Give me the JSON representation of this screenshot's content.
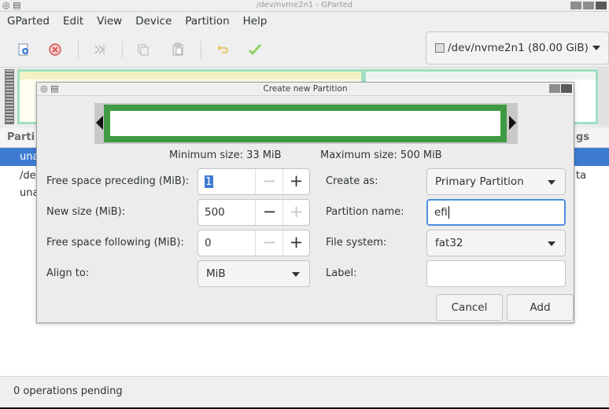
{
  "window": {
    "title": "/dev/nvme2n1 - GParted"
  },
  "menubar": [
    "GParted",
    "Edit",
    "View",
    "Device",
    "Partition",
    "Help"
  ],
  "toolbar": {
    "icons": [
      "new-partition-icon",
      "delete-icon",
      "resize-move-icon",
      "copy-icon",
      "paste-icon",
      "undo-icon",
      "apply-icon"
    ]
  },
  "device_selector": {
    "value": "/dev/nvme2n1 (80.00 GiB)"
  },
  "list": {
    "header_left": "Parti",
    "header_right": "gs",
    "rows": [
      {
        "c1": "una",
        "c2": ""
      },
      {
        "c1": "/de",
        "c2": "ta"
      },
      {
        "c1": "una",
        "c2": ""
      }
    ]
  },
  "statusbar": {
    "text": "0 operations pending"
  },
  "dialog": {
    "title": "Create new Partition",
    "min_size": "Minimum size: 33 MiB",
    "max_size": "Maximum size: 500 MiB",
    "free_preceding_label": "Free space preceding (MiB):",
    "free_preceding_value": "1",
    "new_size_label": "New size (MiB):",
    "new_size_value": "500",
    "free_following_label": "Free space following (MiB):",
    "free_following_value": "0",
    "align_label": "Align to:",
    "align_value": "MiB",
    "create_as_label": "Create as:",
    "create_as_value": "Primary Partition",
    "partition_name_label": "Partition name:",
    "partition_name_value": "efi",
    "file_system_label": "File system:",
    "file_system_value": "fat32",
    "label_label": "Label:",
    "label_value": "",
    "cancel": "Cancel",
    "add": "Add"
  }
}
